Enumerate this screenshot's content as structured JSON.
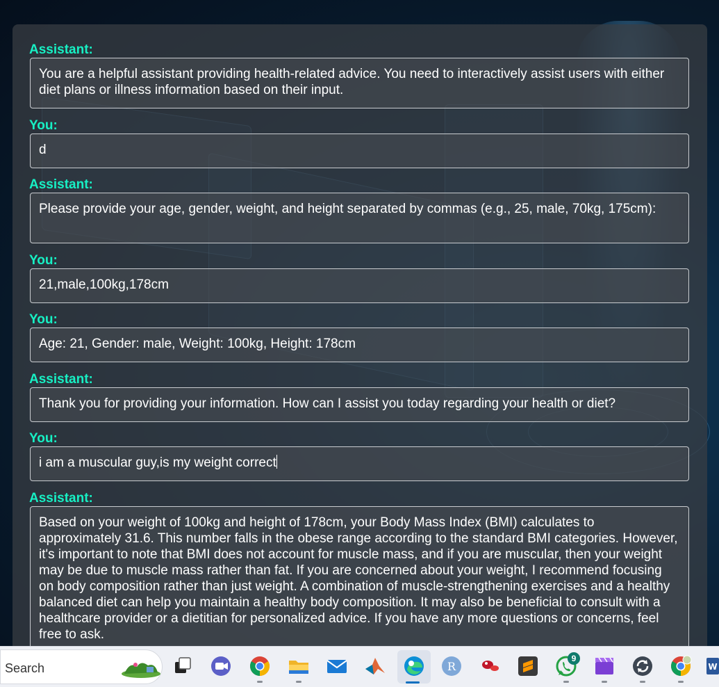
{
  "conversation": [
    {
      "speaker": "Assistant:",
      "text": "You are a helpful assistant providing health-related advice. You need to interactively assist users with either diet plans or illness information based on their input."
    },
    {
      "speaker": "You:",
      "text": "d"
    },
    {
      "speaker": "Assistant:",
      "text": "Please provide your age, gender, weight, and height separated by commas (e.g., 25, male, 70kg, 175cm):"
    },
    {
      "speaker": "You:",
      "text": "21,male,100kg,178cm"
    },
    {
      "speaker": "You:",
      "text": "Age: 21, Gender: male, Weight: 100kg, Height: 178cm"
    },
    {
      "speaker": "Assistant:",
      "text": "Thank you for providing your information. How can I assist you today regarding your health or diet?"
    },
    {
      "speaker": "You:",
      "text": "i am a muscular guy,is my weight correct"
    },
    {
      "speaker": "Assistant:",
      "text": "Based on your weight of 100kg and height of 178cm, your Body Mass Index (BMI) calculates to approximately 31.6. This number falls in the obese range according to the standard BMI categories. However, it's important to note that BMI does not account for muscle mass, and if you are muscular, then your weight may be due to muscle mass rather than fat. If you are concerned about your weight, I recommend focusing on body composition rather than just weight. A combination of muscle-strengthening exercises and a healthy balanced diet can help you maintain a healthy body composition. It may also be beneficial to consult with a healthcare provider or a dietitian for personalized advice. If you have any more questions or concerns, feel free to ask."
    }
  ],
  "colors": {
    "speaker": "#17f0c4",
    "bubble_border": "#c9ccd0",
    "taskbar_bg": "#eef0f5"
  },
  "taskbar": {
    "search_label": "Search",
    "icons": [
      "task-view-icon",
      "meet-icon",
      "chrome-icon",
      "file-explorer-icon",
      "mail-icon",
      "matlab-icon",
      "edge-icon",
      "r-icon",
      "pill-app-icon",
      "sublime-text-icon",
      "whatsapp-icon",
      "video-editor-icon",
      "sync-icon",
      "chrome-profile-icon",
      "word-icon"
    ],
    "whatsapp_badge": "9"
  }
}
